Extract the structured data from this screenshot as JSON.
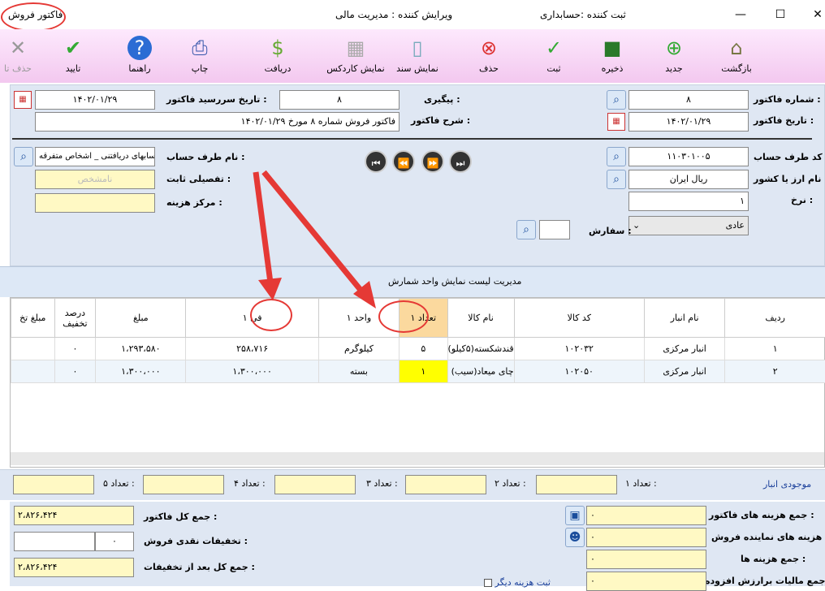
{
  "window": {
    "title": "فاکتور فروش",
    "creator": "ثبت کننده :حسابداری",
    "editor": "ویرایش کننده : مدیریت مالی"
  },
  "toolbar": {
    "back": "بازگشت",
    "new": "جدید",
    "save": "ذخیره",
    "register": "ثبت",
    "delete": "حذف",
    "show_doc": "نمایش سند",
    "show_cardex": "نمایش کاردکس",
    "receive": "دریافت",
    "print": "چاپ",
    "help": "راهنما",
    "confirm": "تایید",
    "delete_conf": "حذف تا"
  },
  "form": {
    "invoice_no_label": "شماره فاکتور :",
    "invoice_no": "۸",
    "invoice_date_label": "تاریخ فاکتور :",
    "invoice_date": "۱۴۰۲/۰۱/۲۹",
    "followup_label": "پیگیری :",
    "followup": "۸",
    "due_date_label": "تاریخ سررسید فاکتور :",
    "due_date": "۱۴۰۲/۰۱/۲۹",
    "description_label": "شرح فاکتور :",
    "description": "فاکتور فروش شماره ۸ مورخ ۱۴۰۲/۰۱/۲۹",
    "account_code_label": "کد طرف حساب :",
    "account_code": "۱۱۰۳۰۱۰۰۵",
    "account_name_label": "نام طرف حساب :",
    "account_name": "حسابهای دریافتنی _ اشخاص متفرقه",
    "currency_label": "نام ارز یا کشور :",
    "currency": "ریال ایران",
    "fixed_detail_label": "تفصیلی ثابت :",
    "fixed_detail": "نامشخص",
    "rate_label": "نرخ :",
    "rate": "۱",
    "cost_center_label": "مرکز هزینه :",
    "cost_center": "",
    "order_label": "سفارش :",
    "order": "",
    "type_value": "عادی"
  },
  "strip_text": "مدیریت لیست نمایش واحد شمارش",
  "grid": {
    "headers": [
      "ردیف",
      "نام انبار",
      "کد کالا",
      "نام کالا",
      "تعداد ۱",
      "واحد ۱",
      "فی ۱",
      "مبلغ",
      "درصد تخفیف",
      "مبلغ تخ"
    ],
    "rows": [
      [
        "۱",
        "انبار مرکزی",
        "۱۰۲۰۳۲",
        "قندشکسته(۵کیلو)",
        "۵",
        "کیلوگرم",
        "۲۵۸،۷۱۶",
        "۱،۲۹۳،۵۸۰",
        "۰",
        ""
      ],
      [
        "۲",
        "انبار مرکزی",
        "۱۰۲۰۵۰",
        "چای میعاد(سیب)",
        "۱",
        "بسته",
        "۱،۳۰۰،۰۰۰",
        "۱،۳۰۰،۰۰۰",
        "۰",
        ""
      ]
    ]
  },
  "stock": {
    "label": "موجودی انبار",
    "q1": "تعداد ۱ :",
    "q2": "تعداد ۲ :",
    "q3": "تعداد ۳ :",
    "q4": "تعداد ۴ :",
    "q5": "تعداد ۵ :"
  },
  "totals": {
    "invoice_costs_label": "جمع هزینه های فاکتور :",
    "invoice_costs": "۰",
    "rep_costs_label": "هزینه های نماینده فروش :",
    "rep_costs": "۰",
    "costs_total_label": "جمع هزینه ها :",
    "costs_total": "۰",
    "vat_label": "جمع مالیات برارزش افزوده :",
    "vat": "۰",
    "total_label": "جمع کل فاکتور :",
    "total": "۲،۸۲۶،۴۲۴",
    "cash_disc_label": "تخفیفات نقدی فروش :",
    "cash_disc": "۰",
    "after_disc_label": "جمع کل بعد از تخفیفات :",
    "after_disc": "۲،۸۲۶،۴۲۴",
    "other_cost_label": "ثبت هزینه دیگر"
  }
}
